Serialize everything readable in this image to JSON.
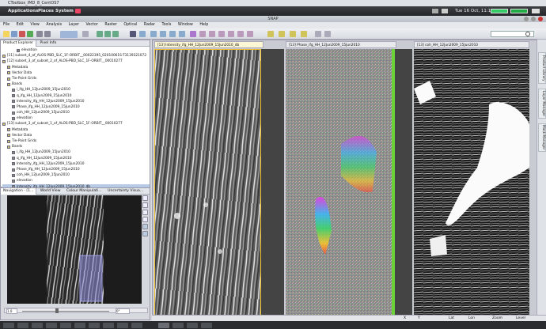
{
  "window": {
    "title": "CToolbox_IMD_8_CentOS7"
  },
  "gnome": {
    "applications": "Applications",
    "places": "Places",
    "system": "System",
    "datetime": "Tue 16 Oct, 11:16"
  },
  "app": {
    "title": "SNAP"
  },
  "menu": [
    "File",
    "Edit",
    "View",
    "Analysis",
    "Layer",
    "Vector",
    "Raster",
    "Optical",
    "Radar",
    "Tools",
    "Window",
    "Help"
  ],
  "left_tabs": {
    "product_explorer": "Product Explorer",
    "pixel_info": "Pixel Info"
  },
  "tree": [
    {
      "text": "elevation",
      "indent": 3,
      "icon": "band"
    },
    {
      "text": "[11] subset_4_of_ALOS-PBD_SLC_1F-ORBIT__00022395_02010061S-T3139321072",
      "indent": 0,
      "icon": "product"
    },
    {
      "text": "[12] subset_3_of_subset_2_of_ALOS-PBD_SLC_1F-ORBIT__00010277",
      "indent": 0,
      "icon": "product"
    },
    {
      "text": "Metadata",
      "indent": 1,
      "icon": "folder"
    },
    {
      "text": "Vector Data",
      "indent": 1,
      "icon": "folder"
    },
    {
      "text": "Tie-Point Grids",
      "indent": 1,
      "icon": "folder"
    },
    {
      "text": "Bands",
      "indent": 1,
      "icon": "folder"
    },
    {
      "text": "i_ifg_HH_12Jun2009_15Jun2010",
      "indent": 2,
      "icon": "band"
    },
    {
      "text": "q_ifg_HH_12Jun2009_15Jun2010",
      "indent": 2,
      "icon": "band"
    },
    {
      "text": "Intensity_ifg_HH_12Jun2009_15Jun2010",
      "indent": 2,
      "icon": "band"
    },
    {
      "text": "Phase_ifg_HH_12Jun2009_15Jun2010",
      "indent": 2,
      "icon": "band"
    },
    {
      "text": "coh_HH_12Jun2009_15Jun2010",
      "indent": 2,
      "icon": "band"
    },
    {
      "text": "elevation",
      "indent": 2,
      "icon": "band"
    },
    {
      "text": "[13] subset_3_of_subset_1_of_ALOS-PBD_SLC_1F-ORBIT__00010277",
      "indent": 0,
      "icon": "product"
    },
    {
      "text": "Metadata",
      "indent": 1,
      "icon": "folder"
    },
    {
      "text": "Vector Data",
      "indent": 1,
      "icon": "folder"
    },
    {
      "text": "Tie-Point Grids",
      "indent": 1,
      "icon": "folder"
    },
    {
      "text": "Bands",
      "indent": 1,
      "icon": "folder"
    },
    {
      "text": "i_ifg_HH_12Jun2009_15Jun2010",
      "indent": 2,
      "icon": "band"
    },
    {
      "text": "q_ifg_HH_12Jun2009_15Jun2010",
      "indent": 2,
      "icon": "band"
    },
    {
      "text": "Intensity_ifg_HH_12Jun2009_15Jun2010",
      "indent": 2,
      "icon": "band"
    },
    {
      "text": "Phase_ifg_HH_12Jun2009_15Jun2010",
      "indent": 2,
      "icon": "band"
    },
    {
      "text": "coh_HH_12Jun2009_15Jun2010",
      "indent": 2,
      "icon": "band"
    },
    {
      "text": "elevation",
      "indent": 2,
      "icon": "band"
    },
    {
      "text": "Intensity_ifg_HH_12Jun2009_15Jun2010_db",
      "indent": 2,
      "icon": "band",
      "selected": true
    }
  ],
  "nav_tabs": {
    "navigation": "Navigation - [1...",
    "world_view": "World View",
    "colour": "Colour Manipulati...",
    "uncertainty": "Uncertainty Visua..."
  },
  "nav": {
    "zoom_value": "1.0",
    "angle_value": "0°"
  },
  "doc_tabs": [
    "[13] Intensity_ifg_HH_12Jun2009_15Jun2010_db",
    "[13] Phase_ifg_HH_12Jun2009_15Jun2010",
    "[13] coh_HH_12Jun2009_15Jun2010"
  ],
  "right_tabs": [
    "Product Library",
    "Layer Manager",
    "Mask Manager"
  ],
  "status": {
    "x": "X",
    "y": "Y",
    "lat": "Lat",
    "lon": "Lon",
    "zoom": "Zoom",
    "level": "Level"
  },
  "colors": {
    "accent_yellow": "#f2c12e",
    "green_edge": "#6cd23a",
    "selection": "#b8cbe6"
  }
}
